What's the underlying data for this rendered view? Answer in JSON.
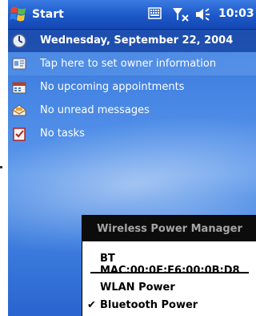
{
  "taskbar": {
    "start_label": "Start",
    "time": "10:03",
    "icons": [
      "windows-flag-icon",
      "keyboard-icon",
      "no-signal-icon",
      "speaker-icon"
    ]
  },
  "today": {
    "date": "Wednesday, September 22, 2004",
    "owner": "Tap here to set owner information",
    "appointments": "No upcoming appointments",
    "messages": "No unread messages",
    "tasks": "No tasks"
  },
  "menu": {
    "title": "Wireless Power Manager",
    "bt_mac": "BT MAC:00:0E:F6:00:0B:D8",
    "wlan": "WLAN Power",
    "bluetooth": "Bluetooth Power",
    "bluetooth_checked": true,
    "check_glyph": "✔"
  },
  "colors": {
    "taskbar": "#1c58c8",
    "menu_title_bg": "#0c0c0c",
    "menu_title_text": "#a5a5a5"
  }
}
